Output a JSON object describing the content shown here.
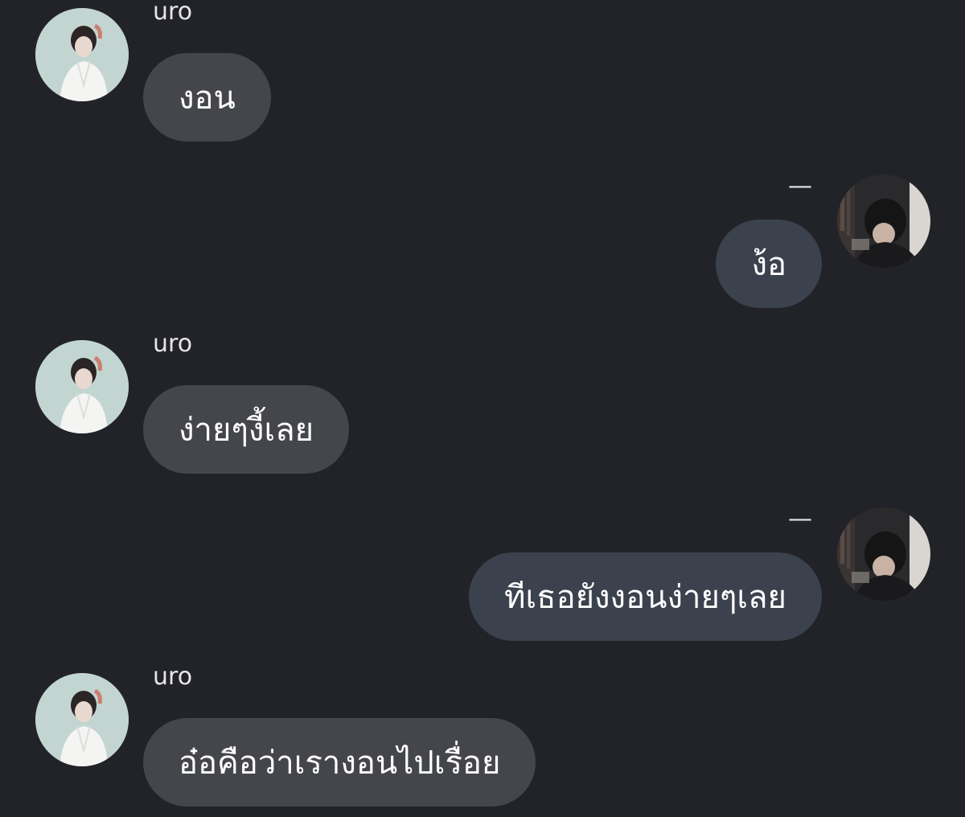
{
  "messages": [
    {
      "direction": "incoming",
      "sender": "uro",
      "text": "งอน",
      "avatar_icon": "profile-photo-uro"
    },
    {
      "direction": "outgoing",
      "sender": "—",
      "text": "ง้อ",
      "avatar_icon": "profile-photo-self"
    },
    {
      "direction": "incoming",
      "sender": "uro",
      "text": "ง่ายๆงี้เลย",
      "avatar_icon": "profile-photo-uro"
    },
    {
      "direction": "outgoing",
      "sender": "—",
      "text": "ทีเธอยังงอนง่ายๆเลย",
      "avatar_icon": "profile-photo-self"
    },
    {
      "direction": "incoming",
      "sender": "uro",
      "text": "อ๋อคือว่าเรางอนไปเรื่อย",
      "avatar_icon": "profile-photo-uro"
    }
  ],
  "colors": {
    "background": "#222329",
    "incoming_bubble": "#45464c",
    "outgoing_bubble": "#3c414e",
    "text": "#ffffff",
    "name": "#e6e6e8"
  }
}
